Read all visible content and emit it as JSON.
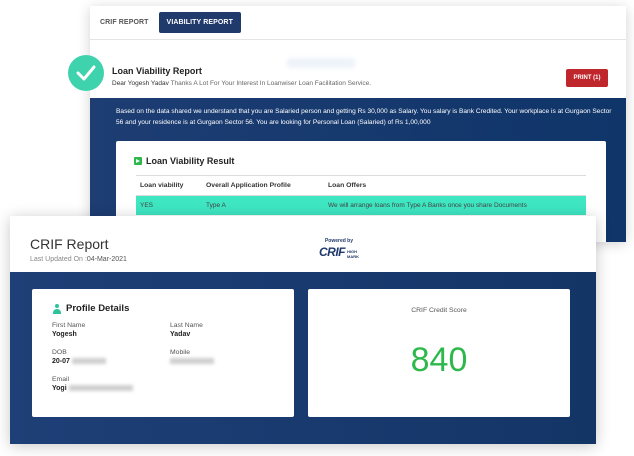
{
  "tabs": [
    {
      "label": "CRIF REPORT"
    },
    {
      "label": "VIABILITY REPORT"
    }
  ],
  "viability": {
    "title": "Loan Viability Report",
    "greeting_name": "Dear Yogesh Yadav",
    "greeting_text": " Thanks A Lot For Your Interest In Loanwiser Loan Facilitation Service.",
    "print_label": "PRINT (1)",
    "summary": "Based on the data shared we understand that you are Salaried person and getting Rs 30,000 as Salary. You salary is Bank Credited. Your workplace is at Gurgaon Sector 56 and your residence is at Gurgaon Sector 56. You are looking for Personal Loan (Salaried) of Rs 1,00,000",
    "result_title": "Loan Viability Result",
    "table": {
      "headers": [
        "Loan viability",
        "Overall Application Profile",
        "Loan Offers"
      ],
      "rows": [
        [
          "YES",
          "Type A",
          "We will arrange loans from Type A Banks once you share Documents"
        ]
      ]
    }
  },
  "crif": {
    "title": "CRIF Report",
    "updated_label": "Last Updated On :",
    "updated_value": "04-Mar-2021",
    "logo": {
      "top": "Powered by",
      "main": "CRIF",
      "sub1": "HIGH",
      "sub2": "MARK"
    },
    "profile": {
      "title": "Profile Details",
      "first_name_label": "First Name",
      "first_name": "Yogesh",
      "last_name_label": "Last Name",
      "last_name": "Yadav",
      "dob_label": "DOB",
      "dob": "20-07",
      "mobile_label": "Mobile",
      "email_label": "Email",
      "email": "Yogi"
    },
    "score_label": "CRIF Credit Score",
    "score": "840"
  },
  "colors": {
    "navy": "#1f3a6b",
    "print_red": "#c0272d",
    "teal_row": "#3ee6c2",
    "score_green": "#2db84b",
    "check_badge": "#3ed3ad"
  }
}
